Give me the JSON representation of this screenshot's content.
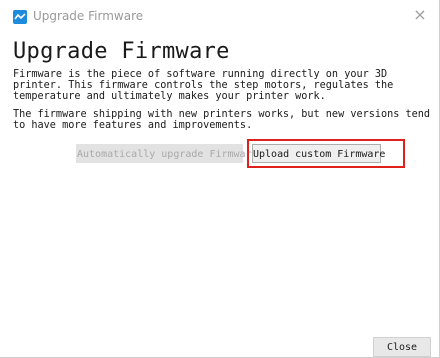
{
  "window": {
    "title": "Upgrade Firmware",
    "close_glyph": "×",
    "icon": "app-logo-icon",
    "icon_color": "#1f8bdc"
  },
  "content": {
    "heading": "Upgrade Firmware",
    "paragraph1": "Firmware is the piece of software running directly on your 3D printer. This firmware controls the step motors, regulates the temperature and ultimately makes your printer work.",
    "paragraph2": "The firmware shipping with new printers works, but new versions tend to have more features and improvements."
  },
  "buttons": {
    "auto_upgrade": "Automatically upgrade Firmware",
    "upload_custom": "Upload custom Firmware",
    "close": "Close"
  },
  "colors": {
    "highlight_box": "#e0201b"
  }
}
